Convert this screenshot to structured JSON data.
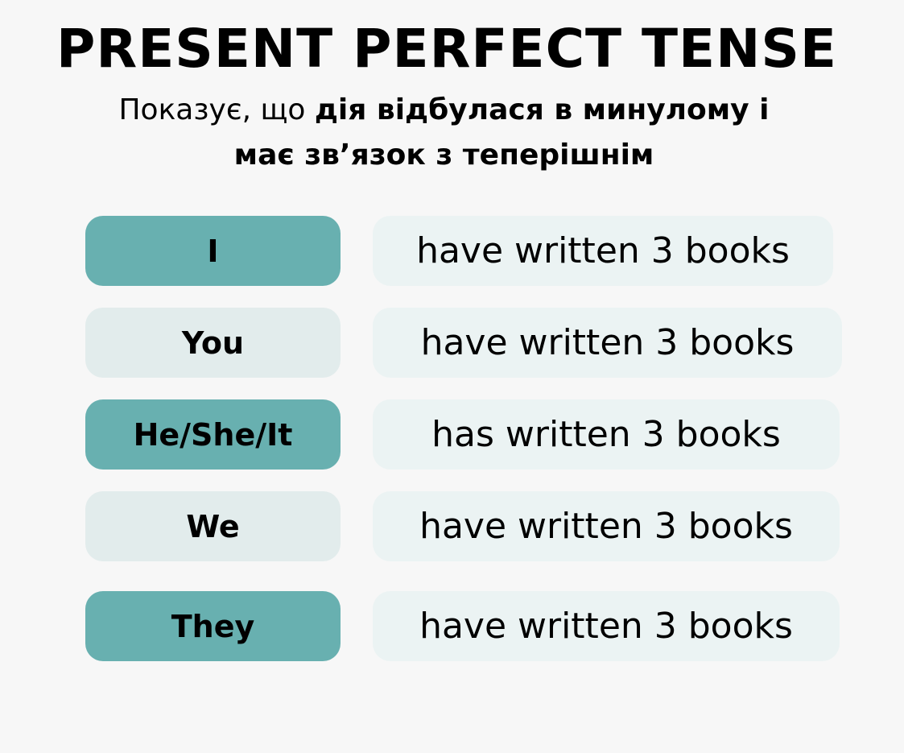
{
  "title": "PRESENT PERFECT TENSE",
  "subtitle": {
    "normal": "Показує, що ",
    "bold_line1": "дія відбулася в минулому і",
    "line2": "має зв’язок з теперішнім"
  },
  "colors": {
    "accent": "#68b0b0",
    "light": "#e2ecec",
    "verb_bg": "#ebf3f3"
  },
  "rows": [
    {
      "pronoun": "I",
      "verb": "have written 3 books"
    },
    {
      "pronoun": "You",
      "verb": "have written 3 books"
    },
    {
      "pronoun": "He/She/It",
      "verb": "has written 3 books"
    },
    {
      "pronoun": "We",
      "verb": "have written 3 books"
    },
    {
      "pronoun": "They",
      "verb": "have written 3 books"
    }
  ]
}
